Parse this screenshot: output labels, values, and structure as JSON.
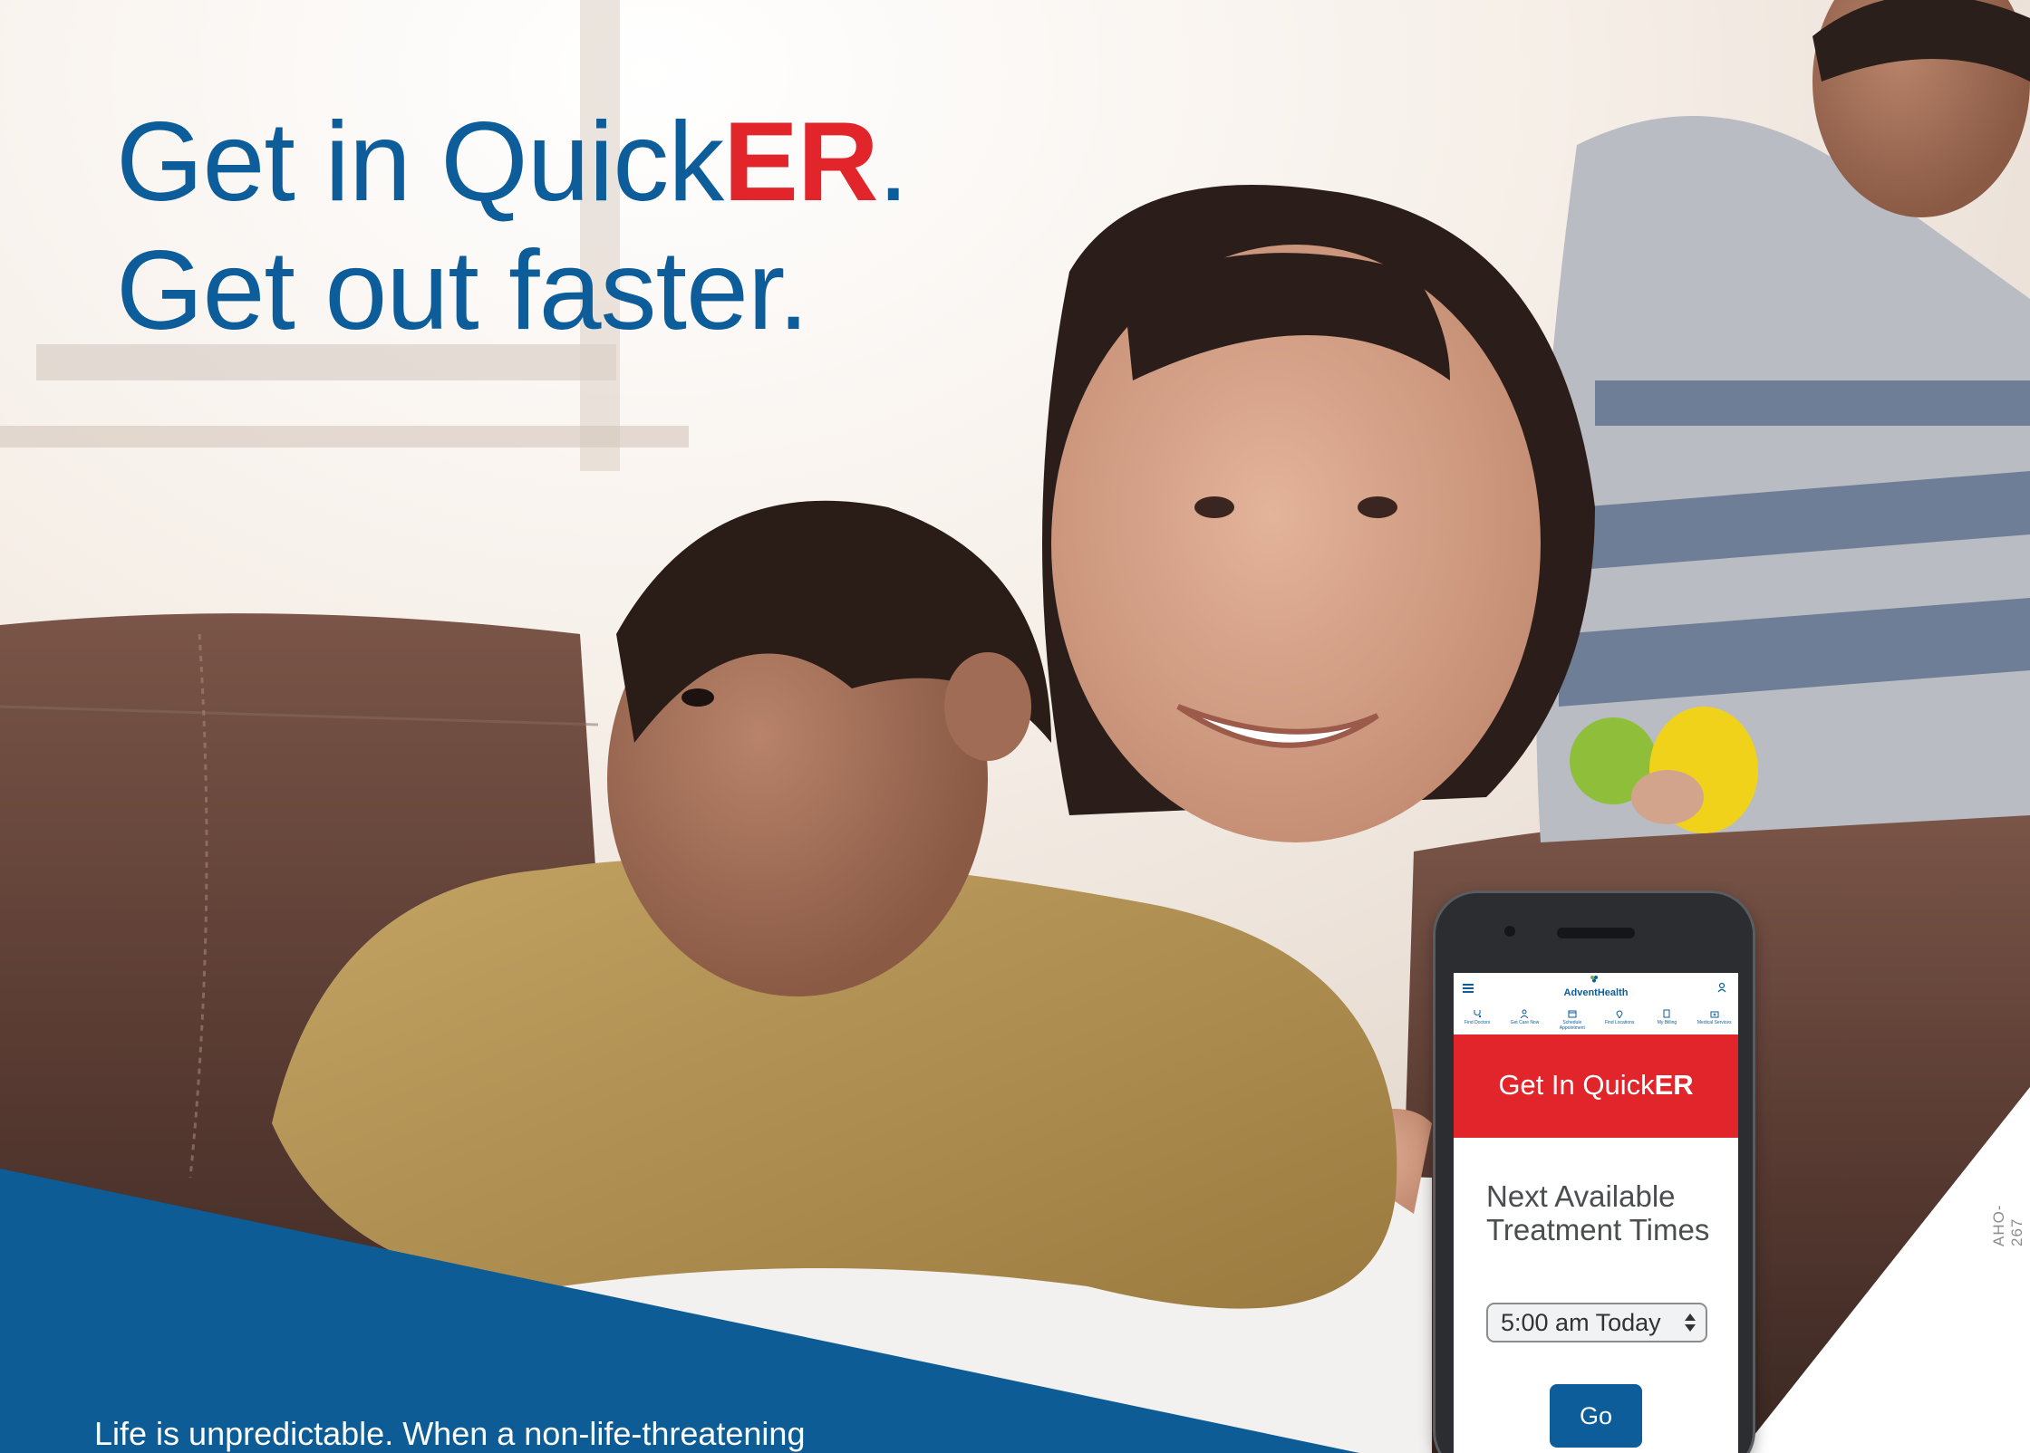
{
  "headline": {
    "line1_prefix": "Get in Quick",
    "line1_emphasis": "ER",
    "line1_suffix": ".",
    "line2": "Get out faster."
  },
  "body_text": "Life is unpredictable. When a non-life-threatening",
  "document_code": "AHO-267",
  "phone": {
    "brand": "AdventHealth",
    "nav": [
      {
        "label": "Find Doctors",
        "icon": "stethoscope-icon"
      },
      {
        "label": "Get Care Now",
        "icon": "person-icon"
      },
      {
        "label": "Schedule Appointment",
        "icon": "calendar-icon"
      },
      {
        "label": "Find Locations",
        "icon": "location-pin-icon"
      },
      {
        "label": "My Billing",
        "icon": "document-icon"
      },
      {
        "label": "Medical Services",
        "icon": "medical-bag-icon"
      }
    ],
    "banner_prefix": "Get In Quick",
    "banner_emphasis": "ER",
    "availability_title": "Next Available Treatment Times",
    "selected_time": "5:00 am Today",
    "go_label": "Go"
  },
  "colors": {
    "brand_blue": "#0c5d99",
    "accent_red": "#e2252b",
    "band_blue": "#0d5c96"
  }
}
